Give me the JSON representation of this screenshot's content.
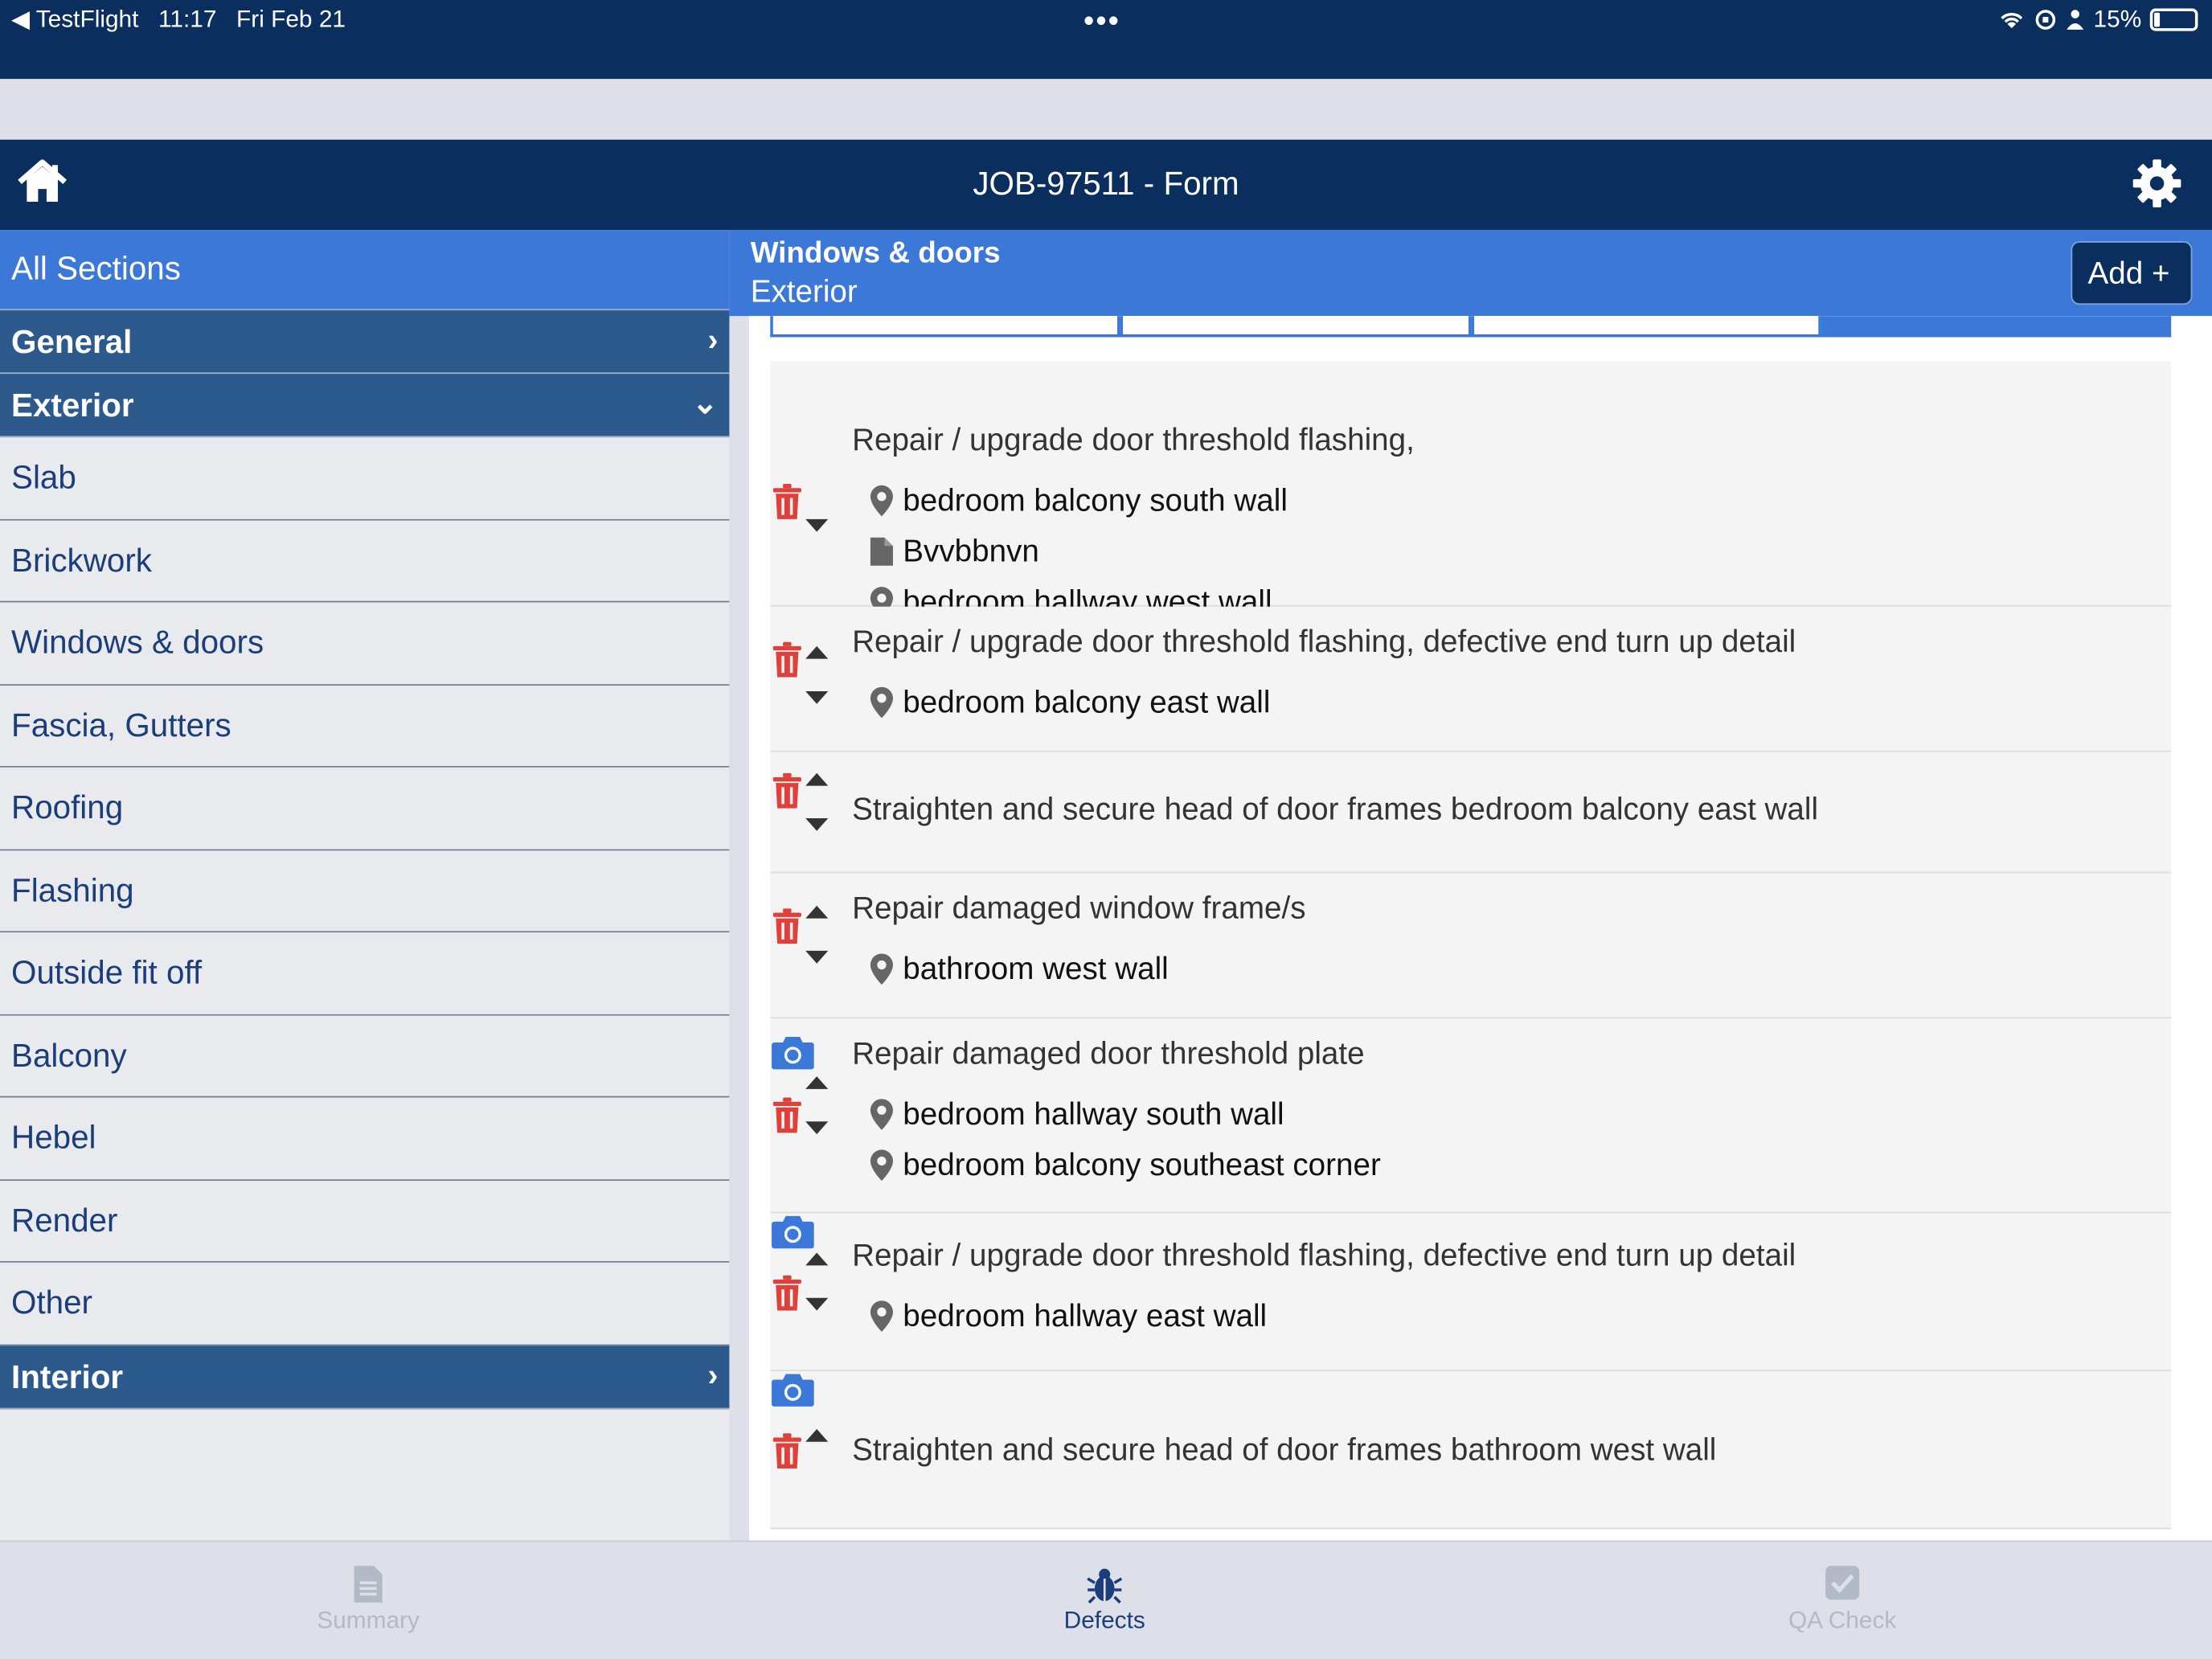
{
  "status_bar": {
    "back_app": "TestFlight",
    "time": "11:17",
    "date": "Fri Feb 21",
    "dots": "•••",
    "battery": "15%"
  },
  "header": {
    "title": "JOB-97511 - Form"
  },
  "sidebar": {
    "all_sections": "All Sections",
    "groups": [
      {
        "label": "General",
        "expanded": false
      },
      {
        "label": "Exterior",
        "expanded": true
      },
      {
        "label": "Interior",
        "expanded": false
      }
    ],
    "items": [
      "Slab",
      "Brickwork",
      "Windows & doors",
      "Fascia, Gutters",
      "Roofing",
      "Flashing",
      "Outside fit off",
      "Balcony",
      "Hebel",
      "Render",
      "Other"
    ]
  },
  "main": {
    "section_title": "Windows & doors",
    "section_subtitle": "Exterior",
    "add_label": "Add +"
  },
  "defects": [
    {
      "description": "Repair / upgrade door threshold flashing,",
      "locations": [
        {
          "icon": "map-pin-icon",
          "text": "bedroom balcony south wall"
        },
        {
          "icon": "document-icon",
          "text": "Bvvbbnvn"
        },
        {
          "icon": "map-pin-icon",
          "text": "bedroom hallway west wall"
        }
      ],
      "has_up": false,
      "has_down": true,
      "has_camera": false
    },
    {
      "description": "Repair / upgrade door threshold flashing, defective end turn up detail",
      "locations": [
        {
          "icon": "map-pin-icon",
          "text": "bedroom balcony east wall"
        }
      ],
      "has_up": true,
      "has_down": true,
      "has_camera": false
    },
    {
      "description": "Straighten and secure head of door frames bedroom balcony east wall",
      "locations": [],
      "has_up": true,
      "has_down": true,
      "has_camera": false
    },
    {
      "description": "Repair damaged window frame/s",
      "locations": [
        {
          "icon": "map-pin-icon",
          "text": "bathroom west wall"
        }
      ],
      "has_up": true,
      "has_down": true,
      "has_camera": false
    },
    {
      "description": "Repair damaged door threshold plate",
      "locations": [
        {
          "icon": "map-pin-icon",
          "text": "bedroom hallway south wall"
        },
        {
          "icon": "map-pin-icon",
          "text": "bedroom balcony southeast corner"
        }
      ],
      "has_up": true,
      "has_down": true,
      "has_camera": true
    },
    {
      "description": "Repair / upgrade door threshold flashing, defective end turn up detail",
      "locations": [
        {
          "icon": "map-pin-icon",
          "text": "bedroom hallway east wall"
        }
      ],
      "has_up": true,
      "has_down": true,
      "has_camera": true
    },
    {
      "description": "Straighten and secure head of door frames bathroom west wall",
      "locations": [],
      "has_up": true,
      "has_down": false,
      "has_camera": true
    }
  ],
  "tabbar": {
    "tabs": [
      {
        "label": "Summary",
        "icon": "document-icon",
        "active": false
      },
      {
        "label": "Defects",
        "icon": "bug-icon",
        "active": true
      },
      {
        "label": "QA Check",
        "icon": "checkbox-icon",
        "active": false
      }
    ]
  },
  "colors": {
    "navy": "#0a2e5e",
    "accent_blue": "#3b78d8",
    "group_blue": "#2c5a8c",
    "delete_red": "#e0403a",
    "camera_blue": "#3b78d8"
  }
}
